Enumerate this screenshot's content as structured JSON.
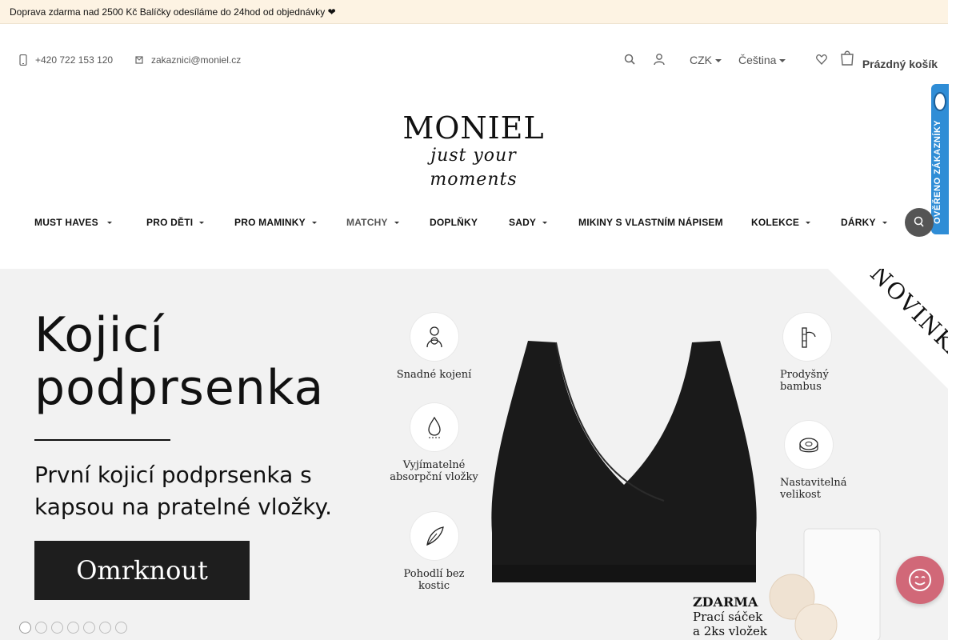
{
  "topbar": {
    "message": "Doprava zdarma nad 2500 Kč  Balíčky odesíláme do 24hod od objednávky ❤",
    "close_glyph": ""
  },
  "contact": {
    "phone": "+420 722 153 120",
    "email": "zakaznici@moniel.cz"
  },
  "header": {
    "currency": "CZK",
    "language": "Čeština",
    "cart_label": "Prázdný košík"
  },
  "logo": {
    "brand": "MONIEL",
    "tagline": "just your moments"
  },
  "nav": {
    "items": [
      {
        "label": "MUST HAVES "
      },
      {
        "label": "PRO DĚTI"
      },
      {
        "label": "PRO MAMINKY"
      },
      {
        "label": "MATCHY"
      },
      {
        "label": "DOPLŇKY"
      },
      {
        "label": "SADY"
      },
      {
        "label": "MIKINY S VLASTNÍM NÁPISEM"
      },
      {
        "label": "KOLEKCE"
      },
      {
        "label": "DÁRKY"
      }
    ]
  },
  "badge": {
    "text": "OVĚŘENO ZÁKAZNÍKY"
  },
  "hero": {
    "title_line1": "Kojicí",
    "title_line2": "podprsenka",
    "subtitle_line1": "První kojicí podprsenka s",
    "subtitle_line2": "kapsou na pratelné vložky.",
    "cta": "Omrknout",
    "ribbon": "NOVINKA",
    "features_left": [
      {
        "line1": "Snadné kojení",
        "line2": "",
        "icon": "breastfeeding-icon"
      },
      {
        "line1": "Vyjímatelné",
        "line2": "absorpční vložky",
        "icon": "droplet-icon"
      },
      {
        "line1": "Pohodlí bez",
        "line2": "kostic",
        "icon": "feather-icon"
      }
    ],
    "features_right": [
      {
        "line1": "Prodyšný",
        "line2": "bambus",
        "icon": "bamboo-icon"
      },
      {
        "line1": "Nastavitelná",
        "line2": "velikost",
        "icon": "measuring-tape-icon"
      }
    ],
    "free_title": "ZDARMA",
    "free_line1": "Prací sáček",
    "free_line2": "a 2ks vložek",
    "slides_count": 7,
    "active_slide": 1
  },
  "colors": {
    "topbar_bg": "#fdf3e3",
    "hero_bg": "#f2f2f2",
    "cta_bg": "#1e1e1e",
    "badge_bg": "#2f8dd6",
    "chat_bg": "#d16878"
  }
}
